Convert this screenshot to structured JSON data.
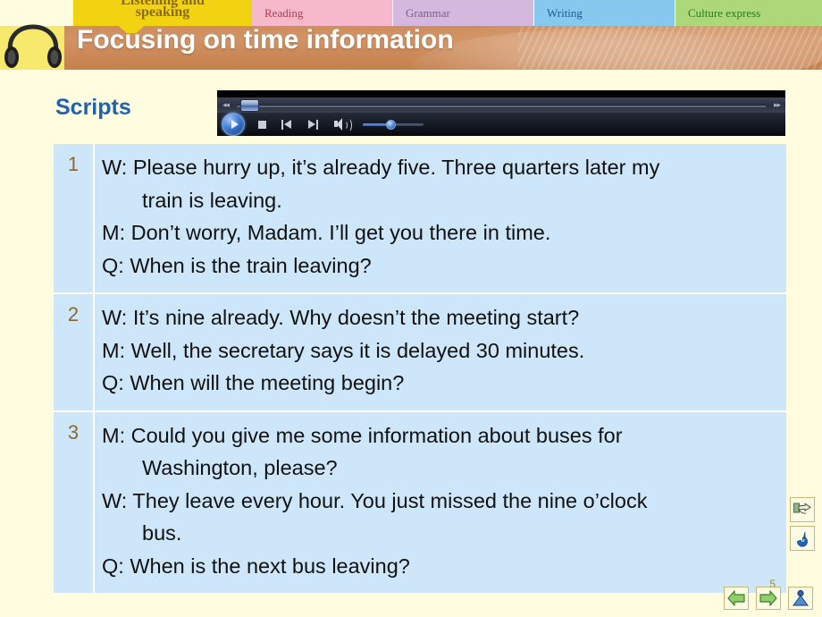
{
  "tabs": [
    {
      "id": "listening-speaking",
      "line1": "Listening and",
      "line2": "speaking",
      "color": "#F2D311",
      "active": true
    },
    {
      "id": "reading",
      "label": "Reading",
      "color": "#F5B9CB"
    },
    {
      "id": "grammar",
      "label": "Grammar",
      "color": "#D5B8DE"
    },
    {
      "id": "writing",
      "label": "Writing",
      "color": "#86C8EE"
    },
    {
      "id": "culture-express",
      "label": "Culture express",
      "color": "#ACD87A"
    }
  ],
  "header": {
    "title": "Focusing on time information",
    "banner_color": "#CE8B58",
    "icon": "headphones-icon"
  },
  "section": {
    "title": "Scripts",
    "title_color": "#1F62B0"
  },
  "player": {
    "play_icon": "play-icon",
    "stop_icon": "stop-icon",
    "prev_icon": "previous-track-icon",
    "next_icon": "next-track-icon",
    "volume_icon": "volume-icon",
    "seek_position_percent": 4,
    "volume_percent": 47
  },
  "scripts": [
    {
      "number": "1",
      "lines": [
        {
          "text": "W: Please hurry up, it’s already five. Three quarters later my",
          "indent": false
        },
        {
          "text": "train is leaving.",
          "indent": true
        },
        {
          "text": "M: Don’t worry, Madam. I’ll get you there in time.",
          "indent": false
        },
        {
          "text": "Q: When is the train leaving?",
          "indent": false
        }
      ]
    },
    {
      "number": "2",
      "lines": [
        {
          "text": "W: It’s nine already. Why doesn’t the meeting start?",
          "indent": false
        },
        {
          "text": "M: Well, the secretary says it is delayed 30 minutes.",
          "indent": false
        },
        {
          "text": "Q: When will the meeting begin?",
          "indent": false
        }
      ]
    },
    {
      "number": "3",
      "lines": [
        {
          "text": "M: Could you give me some information about buses for",
          "indent": false
        },
        {
          "text": "Washington, please?",
          "indent": true
        },
        {
          "text": "W: They leave every hour. You just missed the nine o’clock",
          "indent": false
        },
        {
          "text": "bus.",
          "indent": true
        },
        {
          "text": "Q: When is the next bus leaving?",
          "indent": false
        }
      ]
    }
  ],
  "side_buttons": [
    {
      "id": "pointing-hand",
      "icon": "pointing-hand-icon"
    },
    {
      "id": "undo",
      "icon": "undo-arrow-icon"
    }
  ],
  "bottom_nav": {
    "slide_number": "5",
    "buttons": [
      {
        "id": "previous",
        "icon": "arrow-left-icon"
      },
      {
        "id": "next",
        "icon": "arrow-right-icon"
      },
      {
        "id": "home",
        "icon": "home-person-icon"
      }
    ]
  },
  "colors": {
    "page_background": "#FFFCE0",
    "row_background": "#CDE6F9",
    "number_color": "#8A6A32"
  }
}
